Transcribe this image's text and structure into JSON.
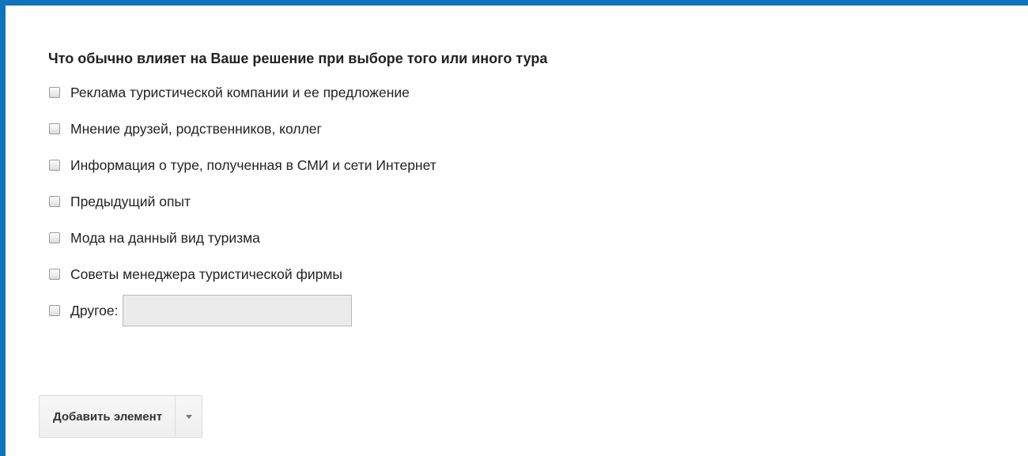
{
  "question": {
    "title": "Что обычно влияет на Ваше решение при выборе того или иного тура",
    "options": [
      {
        "label": "Реклама туристической компании и ее предложение",
        "checked": false
      },
      {
        "label": "Мнение друзей, родственников, коллег",
        "checked": false
      },
      {
        "label": "Информация о туре, полученная в СМИ и сети Интернет",
        "checked": false
      },
      {
        "label": "Предыдущий опыт",
        "checked": false
      },
      {
        "label": "Мода на данный вид туризма",
        "checked": false
      },
      {
        "label": "Советы менеджера туристической фирмы",
        "checked": false
      }
    ],
    "other": {
      "label": "Другое:",
      "value": "",
      "checked": false
    }
  },
  "toolbar": {
    "add_item_label": "Добавить элемент",
    "dropdown_icon": "chevron-down-icon"
  },
  "colors": {
    "accent": "#0f73bd"
  }
}
